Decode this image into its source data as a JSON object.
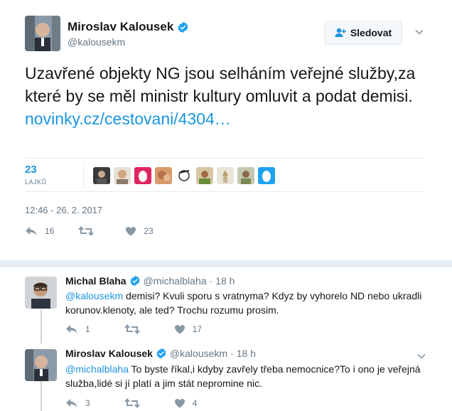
{
  "tweet": {
    "author_name": "Miroslav Kalousek",
    "author_handle": "@kalousekm",
    "follow_label": "Sledovat",
    "text": "Uzavřené objekty NG jsou selháním veřejné služby,za které by se měl ministr kultury omluvit a podat demisi.",
    "link": "novinky.cz/cestovani/4304…",
    "likes_count": "23",
    "likes_label": "LAJKŮ",
    "timestamp": "12:46 - 26. 2. 2017",
    "reply_count": "16",
    "retweet_count": "",
    "like_count": "23"
  },
  "replies": [
    {
      "name": "Michal Blaha",
      "handle": "@michalblaha",
      "sep": "·",
      "time": "18 h",
      "mention": "@kalousekm",
      "text": " demisi? Kvuli sporu s vratnyma? Kdyz by vyhorelo ND nebo ukradli korunov.klenoty, ale ted? Trochu rozumu prosim.",
      "reply_count": "1",
      "like_count": "17"
    },
    {
      "name": "Miroslav Kalousek",
      "handle": "@kalousekm",
      "sep": "·",
      "time": "18 h",
      "mention": "@michalblaha",
      "text": " To byste říkal,i kdyby zavřely třeba nemocnice?To i ono je veřejná služba,lidé si jí platí a jim stát nepromine nic.",
      "reply_count": "3",
      "like_count": "4"
    }
  ],
  "colors": {
    "link": "#1b95e0",
    "muted": "#657786",
    "verified": "#1da1f2",
    "border": "#e6ecf0"
  }
}
